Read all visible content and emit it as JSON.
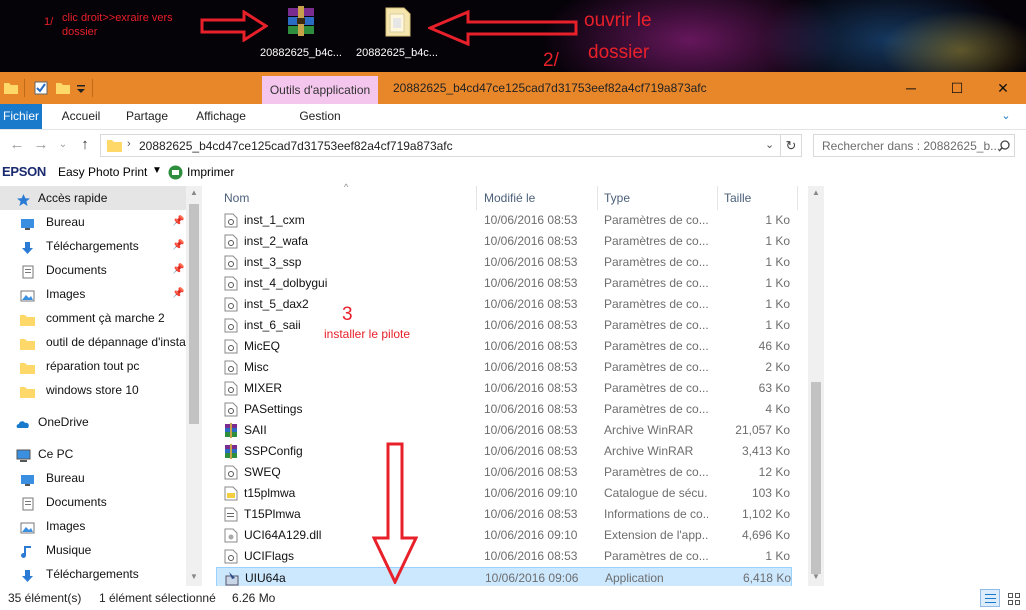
{
  "desktop": {
    "icons": [
      {
        "label": "20882625_b4c...",
        "icon": "winrar-archive-icon"
      },
      {
        "label": "20882625_b4c...",
        "icon": "folder-icon"
      }
    ],
    "annotations": {
      "step1_number": "1/",
      "step1_text_line1": "clic droit>>exraire vers",
      "step1_text_line2": "dossier",
      "step2_text_line1": "ouvrir le",
      "step2_text_line2": "dossier",
      "step2_number": "2/",
      "step3_number": "3",
      "step3_text": "installer le pilote"
    },
    "annotation_color": "#e8202a"
  },
  "window": {
    "title": "20882625_b4cd47ce125cad7d31753eef82a4cf719a873afc",
    "contextual_tab": "Outils d'application",
    "controls": [
      "─",
      "☐",
      "✕"
    ],
    "accent": "#e8862a"
  },
  "ribbon": {
    "tabs": [
      "Fichier",
      "Accueil",
      "Partage",
      "Affichage",
      "Gestion"
    ],
    "file_tab_color": "#1979ca"
  },
  "address": {
    "path": "20882625_b4cd47ce125cad7d31753eef82a4cf719a873afc",
    "search_placeholder": "Rechercher dans : 20882625_b..."
  },
  "toolbar2": {
    "brand": "EPSON",
    "app": "Easy Photo Print",
    "print": "Imprimer"
  },
  "nav": {
    "items": [
      {
        "label": "Accès rapide",
        "icon": "star-icon",
        "level": 0,
        "pinned": false,
        "selected": true
      },
      {
        "label": "Bureau",
        "icon": "desktop-icon",
        "level": 1,
        "pinned": true
      },
      {
        "label": "Téléchargements",
        "icon": "download-icon",
        "level": 1,
        "pinned": true
      },
      {
        "label": "Documents",
        "icon": "documents-icon",
        "level": 1,
        "pinned": true
      },
      {
        "label": "Images",
        "icon": "images-icon",
        "level": 1,
        "pinned": true
      },
      {
        "label": "comment çà marche 2",
        "icon": "folder-icon",
        "level": 1,
        "pinned": false
      },
      {
        "label": "outil de dépannage d'insta",
        "icon": "folder-icon",
        "level": 1,
        "pinned": false
      },
      {
        "label": "réparation tout pc",
        "icon": "folder-icon",
        "level": 1,
        "pinned": false
      },
      {
        "label": "windows store 10",
        "icon": "folder-icon",
        "level": 1,
        "pinned": false
      },
      {
        "label": "OneDrive",
        "icon": "onedrive-icon",
        "level": 0,
        "pinned": false,
        "gap": true
      },
      {
        "label": "Ce PC",
        "icon": "computer-icon",
        "level": 0,
        "pinned": false,
        "gap": true
      },
      {
        "label": "Bureau",
        "icon": "desktop-icon",
        "level": 1,
        "pinned": false
      },
      {
        "label": "Documents",
        "icon": "documents-icon",
        "level": 1,
        "pinned": false
      },
      {
        "label": "Images",
        "icon": "images-icon",
        "level": 1,
        "pinned": false
      },
      {
        "label": "Musique",
        "icon": "music-icon",
        "level": 1,
        "pinned": false
      },
      {
        "label": "Téléchargements",
        "icon": "download-icon",
        "level": 1,
        "pinned": false
      }
    ]
  },
  "files": {
    "columns": [
      "Nom",
      "Modifié le",
      "Type",
      "Taille"
    ],
    "rows": [
      {
        "name": "inst_1_cxm",
        "date": "10/06/2016 08:53",
        "type": "Paramètres de co...",
        "size": "1 Ko",
        "icon": "settings-file-icon"
      },
      {
        "name": "inst_2_wafa",
        "date": "10/06/2016 08:53",
        "type": "Paramètres de co...",
        "size": "1 Ko",
        "icon": "settings-file-icon"
      },
      {
        "name": "inst_3_ssp",
        "date": "10/06/2016 08:53",
        "type": "Paramètres de co...",
        "size": "1 Ko",
        "icon": "settings-file-icon"
      },
      {
        "name": "inst_4_dolbygui",
        "date": "10/06/2016 08:53",
        "type": "Paramètres de co...",
        "size": "1 Ko",
        "icon": "settings-file-icon"
      },
      {
        "name": "inst_5_dax2",
        "date": "10/06/2016 08:53",
        "type": "Paramètres de co...",
        "size": "1 Ko",
        "icon": "settings-file-icon"
      },
      {
        "name": "inst_6_saii",
        "date": "10/06/2016 08:53",
        "type": "Paramètres de co...",
        "size": "1 Ko",
        "icon": "settings-file-icon"
      },
      {
        "name": "MicEQ",
        "date": "10/06/2016 08:53",
        "type": "Paramètres de co...",
        "size": "46 Ko",
        "icon": "settings-file-icon"
      },
      {
        "name": "Misc",
        "date": "10/06/2016 08:53",
        "type": "Paramètres de co...",
        "size": "2 Ko",
        "icon": "settings-file-icon"
      },
      {
        "name": "MIXER",
        "date": "10/06/2016 08:53",
        "type": "Paramètres de co...",
        "size": "63 Ko",
        "icon": "settings-file-icon"
      },
      {
        "name": "PASettings",
        "date": "10/06/2016 08:53",
        "type": "Paramètres de co...",
        "size": "4 Ko",
        "icon": "settings-file-icon"
      },
      {
        "name": "SAII",
        "date": "10/06/2016 08:53",
        "type": "Archive WinRAR",
        "size": "21,057 Ko",
        "icon": "winrar-archive-icon"
      },
      {
        "name": "SSPConfig",
        "date": "10/06/2016 08:53",
        "type": "Archive WinRAR",
        "size": "3,413 Ko",
        "icon": "winrar-archive-icon"
      },
      {
        "name": "SWEQ",
        "date": "10/06/2016 08:53",
        "type": "Paramètres de co...",
        "size": "12 Ko",
        "icon": "settings-file-icon"
      },
      {
        "name": "t15plmwa",
        "date": "10/06/2016 09:10",
        "type": "Catalogue de sécu...",
        "size": "103 Ko",
        "icon": "catalog-file-icon"
      },
      {
        "name": "T15Plmwa",
        "date": "10/06/2016 08:53",
        "type": "Informations de co...",
        "size": "1,102 Ko",
        "icon": "setup-info-file-icon"
      },
      {
        "name": "UCI64A129.dll",
        "date": "10/06/2016 09:10",
        "type": "Extension de l'app...",
        "size": "4,696 Ko",
        "icon": "dll-file-icon"
      },
      {
        "name": "UCIFlags",
        "date": "10/06/2016 08:53",
        "type": "Paramètres de co...",
        "size": "1 Ko",
        "icon": "settings-file-icon"
      },
      {
        "name": "UIU64a",
        "date": "10/06/2016 09:06",
        "type": "Application",
        "size": "6,418 Ko",
        "icon": "installer-app-icon",
        "selected": true
      }
    ]
  },
  "status": {
    "count": "35 élément(s)",
    "selection": "1 élément sélectionné",
    "size": "6.26 Mo"
  }
}
